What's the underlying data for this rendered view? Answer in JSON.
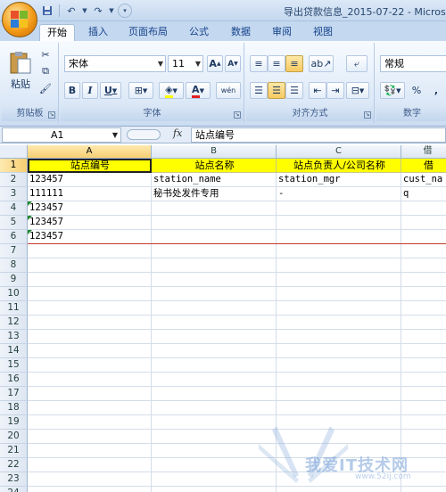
{
  "window": {
    "title": "导出贷款信息_2015-07-22 - Microso"
  },
  "qat": {
    "save_icon": "save-icon",
    "undo_icon": "undo-icon",
    "redo_icon": "redo-icon"
  },
  "tabs": [
    {
      "label": "开始",
      "active": true
    },
    {
      "label": "插入"
    },
    {
      "label": "页面布局"
    },
    {
      "label": "公式"
    },
    {
      "label": "数据"
    },
    {
      "label": "审阅"
    },
    {
      "label": "视图"
    }
  ],
  "ribbon": {
    "clipboard": {
      "label": "剪贴板",
      "paste": "粘贴"
    },
    "font": {
      "label": "字体",
      "name": "宋体",
      "size": "11",
      "grow": "A",
      "shrink": "A",
      "bold": "B",
      "italic": "I",
      "underline": "U",
      "font_color": "A",
      "phonetic": "wén"
    },
    "alignment": {
      "label": "对齐方式"
    },
    "number": {
      "label": "数字",
      "format": "常规",
      "percent": "%",
      "comma": ","
    }
  },
  "formula_bar": {
    "name_box": "A1",
    "fx": "fx",
    "formula": "站点编号"
  },
  "sheet": {
    "columns": [
      "A",
      "B",
      "C",
      "借"
    ],
    "rows": [
      "1",
      "2",
      "3",
      "4",
      "5",
      "6",
      "7",
      "8",
      "9",
      "10",
      "11",
      "12",
      "13",
      "14",
      "15",
      "16",
      "17",
      "18",
      "19",
      "20",
      "21",
      "22",
      "23",
      "24"
    ],
    "header_row": [
      "站点编号",
      "站点名称",
      "站点负责人/公司名称",
      "借"
    ],
    "data": [
      [
        "123457",
        "station_name",
        "station_mgr",
        "cust_na"
      ],
      [
        "111111",
        "秘书处发件专用",
        "-",
        "q"
      ],
      [
        "123457",
        "",
        "",
        ""
      ],
      [
        "123457",
        "",
        "",
        ""
      ],
      [
        "123457",
        "",
        "",
        ""
      ]
    ]
  },
  "watermark": {
    "text": "我爱IT技术网",
    "url": "www.52ij.com"
  },
  "colors": {
    "header_fill": "#ffff00",
    "ribbon": "#dde9f7",
    "accent": "#f29a16"
  }
}
